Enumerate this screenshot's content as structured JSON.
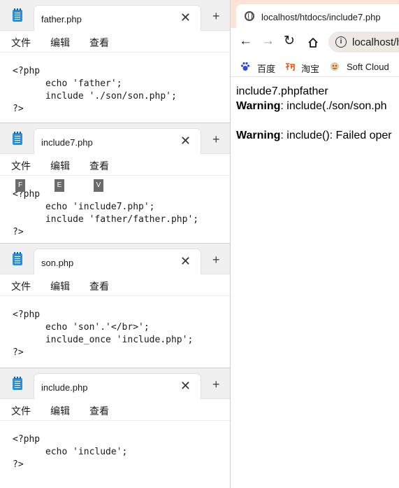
{
  "windows": [
    {
      "id": "father",
      "tab_title": "father.php",
      "menu": [
        "文件",
        "编辑",
        "查看"
      ],
      "code": "<?php\n\techo 'father';\n\tinclude './son/son.php';\n?>",
      "keytips": []
    },
    {
      "id": "include7",
      "tab_title": "include7.php",
      "menu": [
        "文件",
        "编辑",
        "查看"
      ],
      "code": "<?php\n\techo 'include7.php';\n\tinclude 'father/father.php';\n?>",
      "keytips": [
        "F",
        "E",
        "V"
      ]
    },
    {
      "id": "son",
      "tab_title": "son.php",
      "menu": [
        "文件",
        "编辑",
        "查看"
      ],
      "code": "<?php\n\techo 'son'.'</br>';\n\tinclude_once 'include.php';\n?>",
      "keytips": []
    },
    {
      "id": "include",
      "tab_title": "include.php",
      "menu": [
        "文件",
        "编辑",
        "查看"
      ],
      "code": "<?php\n\techo 'include';\n?>",
      "keytips": []
    }
  ],
  "browser": {
    "tab_title": "localhost/htdocs/include7.php",
    "url": "localhost/h",
    "bookmarks": [
      "百度",
      "淘宝",
      "Soft Cloud"
    ],
    "output": {
      "line1": "include7.phpfather",
      "warn_label_1": "Warning",
      "warn_text_1": ": include(./son/son.ph",
      "warn_label_2": "Warning",
      "warn_text_2": ": include(): Failed oper"
    }
  },
  "colors": {
    "notepad_icon": "#2f8fd6",
    "browser_tabstrip": "#fde3d6",
    "keytip_bg": "#6b6b6b"
  }
}
